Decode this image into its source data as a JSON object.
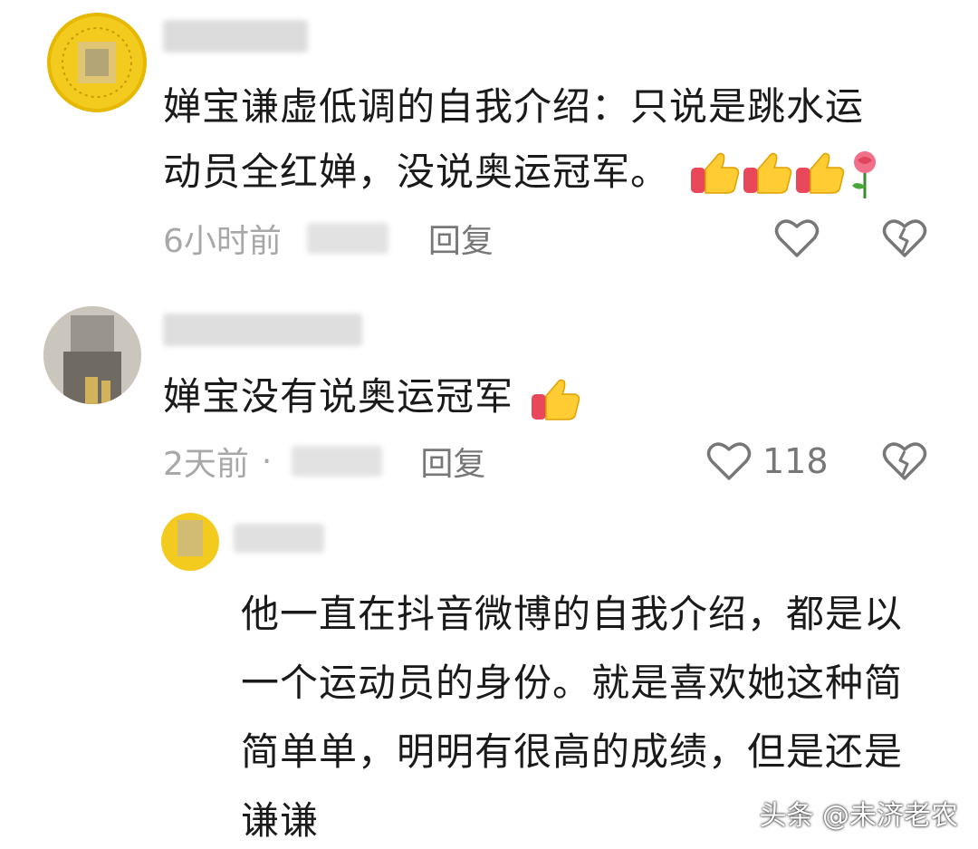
{
  "comments": [
    {
      "text_lines": [
        "婵宝谦虚低调的自我介绍：只说是跳水运",
        "动员全红婵，没说奥运冠军。"
      ],
      "time": "6小时前",
      "reply_label": "回复"
    },
    {
      "text_lines": [
        "婵宝没有说奥运冠军"
      ],
      "time": "2天前",
      "separator": "·",
      "reply_label": "回复",
      "like_count": "118"
    },
    {
      "text_lines": [
        "他一直在抖音微博的自我介绍，都是以",
        "一个运动员的身份。就是喜欢她这种简",
        "简单单，明明有很高的成绩，但是还是",
        "谦谦"
      ]
    }
  ],
  "watermark": "头条 @未济老农",
  "colors": {
    "text": "#1a1a1a",
    "meta": "#a8a8a8",
    "icon": "#777777",
    "gold_avatar": "#f3cb1e"
  }
}
